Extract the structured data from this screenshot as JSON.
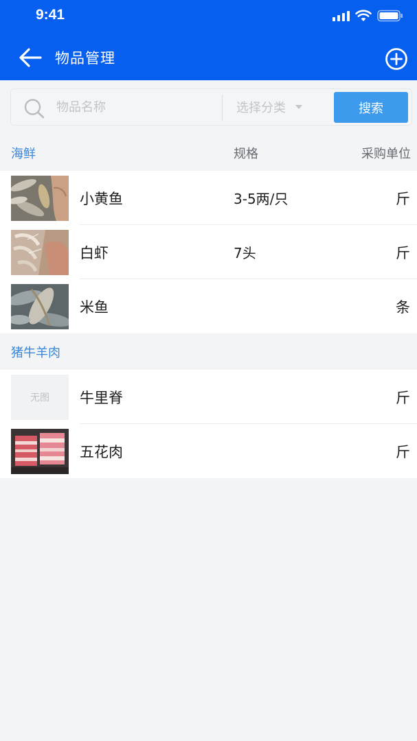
{
  "status_bar": {
    "time": "9:41"
  },
  "nav": {
    "title": "物品管理"
  },
  "search": {
    "placeholder": "物品名称",
    "category_placeholder": "选择分类",
    "button_label": "搜索"
  },
  "columns": {
    "spec": "规格",
    "unit": "采购单位"
  },
  "sections": [
    {
      "title": "海鲜",
      "items": [
        {
          "name": "小黄鱼",
          "spec": "3-5两/只",
          "unit": "斤",
          "image": "fish-yellow"
        },
        {
          "name": "白虾",
          "spec": "7头",
          "unit": "斤",
          "image": "shrimp"
        },
        {
          "name": "米鱼",
          "spec": "",
          "unit": "条",
          "image": "fish-mi"
        }
      ]
    },
    {
      "title": "猪牛羊肉",
      "items": [
        {
          "name": "牛里脊",
          "spec": "",
          "unit": "斤",
          "image": "none",
          "no_image_text": "无图"
        },
        {
          "name": "五花肉",
          "spec": "",
          "unit": "斤",
          "image": "pork-belly"
        }
      ]
    }
  ],
  "colors": {
    "primary": "#075ff0",
    "accent": "#3d9aec",
    "section_title": "#3a86d8"
  }
}
